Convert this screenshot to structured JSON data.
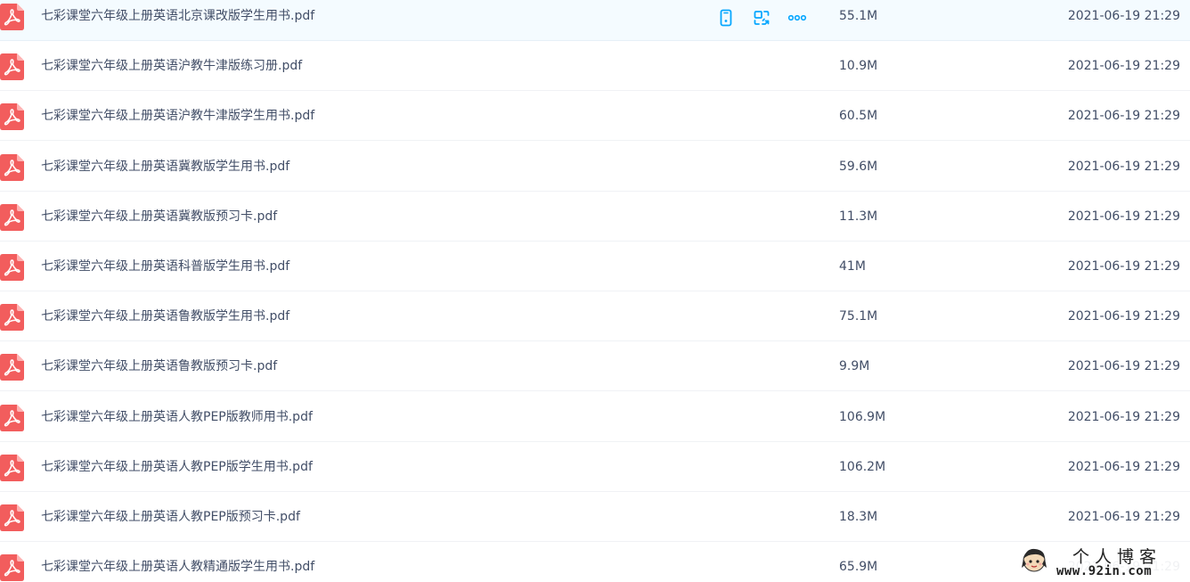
{
  "files": [
    {
      "name": "七彩课堂六年级上册英语北京课改版学生用书.pdf",
      "size": "55.1M",
      "date": "2021-06-19 21:29",
      "hovered": true
    },
    {
      "name": "七彩课堂六年级上册英语沪教牛津版练习册.pdf",
      "size": "10.9M",
      "date": "2021-06-19 21:29"
    },
    {
      "name": "七彩课堂六年级上册英语沪教牛津版学生用书.pdf",
      "size": "60.5M",
      "date": "2021-06-19 21:29"
    },
    {
      "name": "七彩课堂六年级上册英语冀教版学生用书.pdf",
      "size": "59.6M",
      "date": "2021-06-19 21:29"
    },
    {
      "name": "七彩课堂六年级上册英语冀教版预习卡.pdf",
      "size": "11.3M",
      "date": "2021-06-19 21:29"
    },
    {
      "name": "七彩课堂六年级上册英语科普版学生用书.pdf",
      "size": "41M",
      "date": "2021-06-19 21:29"
    },
    {
      "name": "七彩课堂六年级上册英语鲁教版学生用书.pdf",
      "size": "75.1M",
      "date": "2021-06-19 21:29"
    },
    {
      "name": "七彩课堂六年级上册英语鲁教版预习卡.pdf",
      "size": "9.9M",
      "date": "2021-06-19 21:29"
    },
    {
      "name": "七彩课堂六年级上册英语人教PEP版教师用书.pdf",
      "size": "106.9M",
      "date": "2021-06-19 21:29"
    },
    {
      "name": "七彩课堂六年级上册英语人教PEP版学生用书.pdf",
      "size": "106.2M",
      "date": "2021-06-19 21:29"
    },
    {
      "name": "七彩课堂六年级上册英语人教PEP版预习卡.pdf",
      "size": "18.3M",
      "date": "2021-06-19 21:29"
    },
    {
      "name": "七彩课堂六年级上册英语人教精通版学生用书.pdf",
      "size": "65.9M",
      "date": "2021-06-19 21:29"
    }
  ],
  "row_actions": [
    {
      "icon": "mobile-icon"
    },
    {
      "icon": "share-link-icon"
    },
    {
      "icon": "more-icon"
    }
  ],
  "watermark": {
    "title": "个人博客",
    "url": "www.92in.com"
  },
  "colors": {
    "pdf_red": "#f25d5d",
    "action_blue": "#06a7ff",
    "text": "#424e67",
    "hover_bg": "#f4fbff"
  }
}
